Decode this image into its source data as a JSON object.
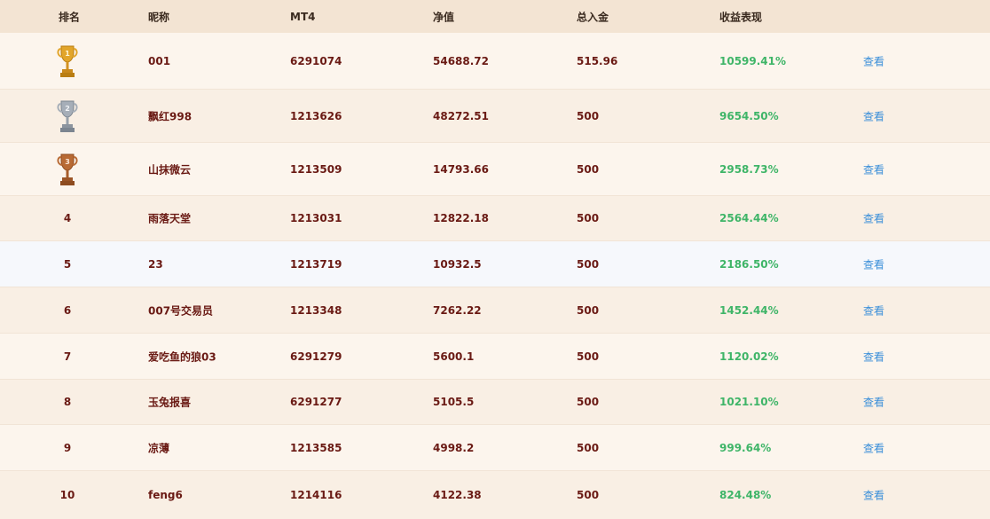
{
  "headers": {
    "rank": "排名",
    "nickname": "昵称",
    "mt4": "MT4",
    "equity": "净值",
    "deposit": "总入金",
    "performance": "收益表现"
  },
  "colors": {
    "header_bg": "#f3e4d3",
    "row_odd": "#fcf5ed",
    "row_even": "#f9efe4",
    "row_highlight": "#f6f8fc",
    "name_text": "#6a1a14",
    "performance_text": "#3fb568",
    "link_text": "#3b8fd9",
    "gold": "#e2a52a",
    "silver": "#a6aeb8",
    "bronze": "#b86a34"
  },
  "rows": [
    {
      "rank": "1",
      "trophy": "gold-trophy-icon",
      "nickname": "001",
      "mt4": "6291074",
      "equity": "54688.72",
      "deposit": "515.96",
      "performance": "10599.41%",
      "view": "查看"
    },
    {
      "rank": "2",
      "trophy": "silver-trophy-icon",
      "nickname": "飘红998",
      "mt4": "1213626",
      "equity": "48272.51",
      "deposit": "500",
      "performance": "9654.50%",
      "view": "查看"
    },
    {
      "rank": "3",
      "trophy": "bronze-trophy-icon",
      "nickname": "山抹微云",
      "mt4": "1213509",
      "equity": "14793.66",
      "deposit": "500",
      "performance": "2958.73%",
      "view": "查看"
    },
    {
      "rank": "4",
      "nickname": "雨落天堂",
      "mt4": "1213031",
      "equity": "12822.18",
      "deposit": "500",
      "performance": "2564.44%",
      "view": "查看"
    },
    {
      "rank": "5",
      "nickname": "23",
      "mt4": "1213719",
      "equity": "10932.5",
      "deposit": "500",
      "performance": "2186.50%",
      "view": "查看"
    },
    {
      "rank": "6",
      "nickname": "007号交易员",
      "mt4": "1213348",
      "equity": "7262.22",
      "deposit": "500",
      "performance": "1452.44%",
      "view": "查看"
    },
    {
      "rank": "7",
      "nickname": "爱吃鱼的狼03",
      "mt4": "6291279",
      "equity": "5600.1",
      "deposit": "500",
      "performance": "1120.02%",
      "view": "查看"
    },
    {
      "rank": "8",
      "nickname": "玉兔报喜",
      "mt4": "6291277",
      "equity": "5105.5",
      "deposit": "500",
      "performance": "1021.10%",
      "view": "查看"
    },
    {
      "rank": "9",
      "nickname": "凉薄",
      "mt4": "1213585",
      "equity": "4998.2",
      "deposit": "500",
      "performance": "999.64%",
      "view": "查看"
    },
    {
      "rank": "10",
      "nickname": "feng6",
      "mt4": "1214116",
      "equity": "4122.38",
      "deposit": "500",
      "performance": "824.48%",
      "view": "查看"
    }
  ]
}
